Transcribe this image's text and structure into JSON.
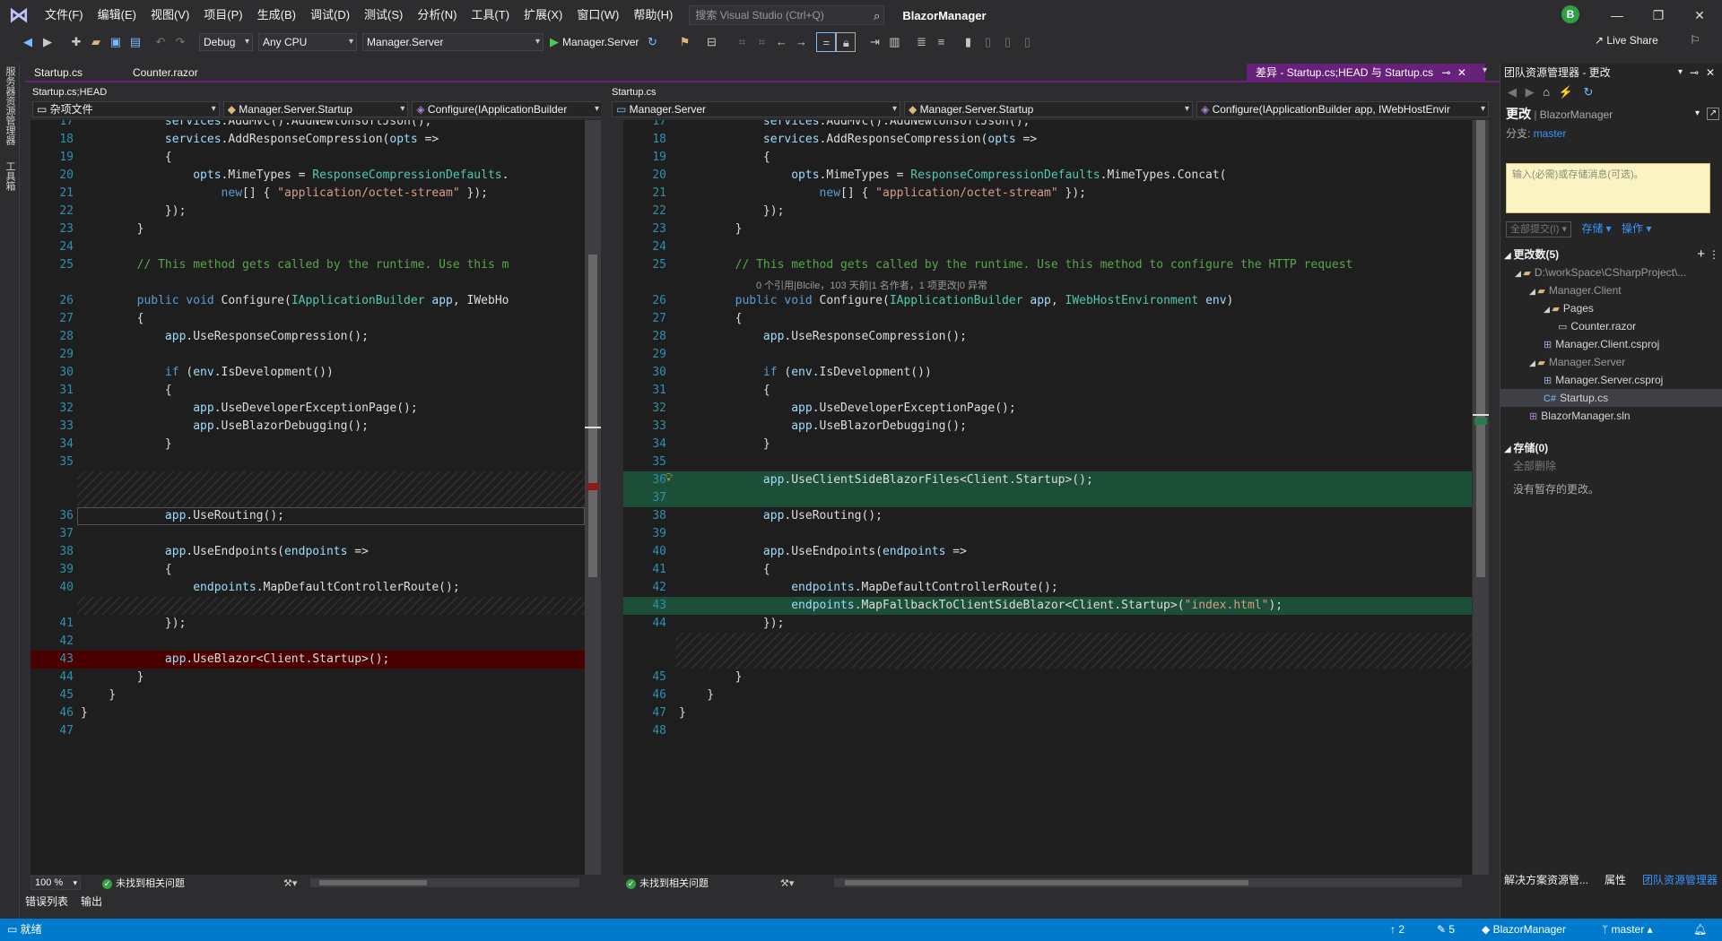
{
  "menubar": {
    "items": [
      "文件(F)",
      "编辑(E)",
      "视图(V)",
      "项目(P)",
      "生成(B)",
      "调试(D)",
      "测试(S)",
      "分析(N)",
      "工具(T)",
      "扩展(X)",
      "窗口(W)",
      "帮助(H)"
    ],
    "search_placeholder": "搜索 Visual Studio (Ctrl+Q)",
    "solution_name": "BlazorManager",
    "avatar_initial": "B"
  },
  "toolbar": {
    "config": "Debug",
    "platform": "Any CPU",
    "startup_project": "Manager.Server",
    "run_label": "Manager.Server",
    "live_share": "Live Share"
  },
  "side_tabs": [
    "服务器资源管理器",
    "工具箱"
  ],
  "tabs": {
    "tab1": "Startup.cs",
    "tab2": "Counter.razor",
    "active": "差异 - Startup.cs;HEAD 与 Startup.cs"
  },
  "left_pane": {
    "path": "Startup.cs;HEAD",
    "nav": [
      "杂项文件",
      "Manager.Server.Startup",
      "Configure(IApplicationBuilder"
    ],
    "zoom": "100 %",
    "issues": "未找到相关问题",
    "lines": [
      {
        "n": "17",
        "t": "            services.AddMvc().AddNewtonsoftJson();"
      },
      {
        "n": "18",
        "t": "            services.AddResponseCompression(opts =>"
      },
      {
        "n": "19",
        "t": "            {"
      },
      {
        "n": "20",
        "t": "                opts.MimeTypes = ResponseCompressionDefaults."
      },
      {
        "n": "21",
        "t": "                    new[] { \"application/octet-stream\" });"
      },
      {
        "n": "22",
        "t": "            });"
      },
      {
        "n": "23",
        "t": "        }"
      },
      {
        "n": "24",
        "t": ""
      },
      {
        "n": "25",
        "t": "        // This method gets called by the runtime. Use this m"
      },
      {
        "n": "",
        "t": ""
      },
      {
        "n": "26",
        "t": "        public void Configure(IApplicationBuilder app, IWebHo"
      },
      {
        "n": "27",
        "t": "        {"
      },
      {
        "n": "28",
        "t": "            app.UseResponseCompression();"
      },
      {
        "n": "29",
        "t": ""
      },
      {
        "n": "30",
        "t": "            if (env.IsDevelopment())"
      },
      {
        "n": "31",
        "t": "            {"
      },
      {
        "n": "32",
        "t": "                app.UseDeveloperExceptionPage();"
      },
      {
        "n": "33",
        "t": "                app.UseBlazorDebugging();"
      },
      {
        "n": "34",
        "t": "            }"
      },
      {
        "n": "35",
        "t": ""
      },
      {
        "n": "",
        "t": ""
      },
      {
        "n": "",
        "t": ""
      },
      {
        "n": "36",
        "t": "            app.UseRouting();"
      },
      {
        "n": "37",
        "t": ""
      },
      {
        "n": "38",
        "t": "            app.UseEndpoints(endpoints =>"
      },
      {
        "n": "39",
        "t": "            {"
      },
      {
        "n": "40",
        "t": "                endpoints.MapDefaultControllerRoute();"
      },
      {
        "n": "",
        "t": ""
      },
      {
        "n": "41",
        "t": "            });"
      },
      {
        "n": "42",
        "t": ""
      },
      {
        "n": "43",
        "t": "            app.UseBlazor<Client.Startup>();"
      },
      {
        "n": "44",
        "t": "        }"
      },
      {
        "n": "45",
        "t": "    }"
      },
      {
        "n": "46",
        "t": "}"
      },
      {
        "n": "47",
        "t": ""
      }
    ]
  },
  "right_pane": {
    "path": "Startup.cs",
    "nav": [
      "Manager.Server",
      "Manager.Server.Startup",
      "Configure(IApplicationBuilder app, IWebHostEnvir"
    ],
    "issues": "未找到相关问题",
    "codelens": "0 个引用|Blcile，103 天前|1 名作者，1 项更改|0 异常",
    "lines": [
      {
        "n": "17",
        "t": "            services.AddMvc().AddNewtonsoftJson();"
      },
      {
        "n": "18",
        "t": "            services.AddResponseCompression(opts =>"
      },
      {
        "n": "19",
        "t": "            {"
      },
      {
        "n": "20",
        "t": "                opts.MimeTypes = ResponseCompressionDefaults.MimeTypes.Concat("
      },
      {
        "n": "21",
        "t": "                    new[] { \"application/octet-stream\" });"
      },
      {
        "n": "22",
        "t": "            });"
      },
      {
        "n": "23",
        "t": "        }"
      },
      {
        "n": "24",
        "t": ""
      },
      {
        "n": "25",
        "t": "        // This method gets called by the runtime. Use this method to configure the HTTP request"
      },
      {
        "n": "",
        "t": ""
      },
      {
        "n": "26",
        "t": "        public void Configure(IApplicationBuilder app, IWebHostEnvironment env)"
      },
      {
        "n": "27",
        "t": "        {"
      },
      {
        "n": "28",
        "t": "            app.UseResponseCompression();"
      },
      {
        "n": "29",
        "t": ""
      },
      {
        "n": "30",
        "t": "            if (env.IsDevelopment())"
      },
      {
        "n": "31",
        "t": "            {"
      },
      {
        "n": "32",
        "t": "                app.UseDeveloperExceptionPage();"
      },
      {
        "n": "33",
        "t": "                app.UseBlazorDebugging();"
      },
      {
        "n": "34",
        "t": "            }"
      },
      {
        "n": "35",
        "t": ""
      },
      {
        "n": "36",
        "t": "            app.UseClientSideBlazorFiles<Client.Startup>();"
      },
      {
        "n": "37",
        "t": ""
      },
      {
        "n": "38",
        "t": "            app.UseRouting();"
      },
      {
        "n": "39",
        "t": ""
      },
      {
        "n": "40",
        "t": "            app.UseEndpoints(endpoints =>"
      },
      {
        "n": "41",
        "t": "            {"
      },
      {
        "n": "42",
        "t": "                endpoints.MapDefaultControllerRoute();"
      },
      {
        "n": "43",
        "t": "                endpoints.MapFallbackToClientSideBlazor<Client.Startup>(\"index.html\");"
      },
      {
        "n": "44",
        "t": "            });"
      },
      {
        "n": "",
        "t": ""
      },
      {
        "n": "",
        "t": ""
      },
      {
        "n": "45",
        "t": "        }"
      },
      {
        "n": "46",
        "t": "    }"
      },
      {
        "n": "47",
        "t": "}"
      },
      {
        "n": "48",
        "t": ""
      }
    ]
  },
  "bottom_tabs": [
    "错误列表",
    "输出"
  ],
  "team_explorer": {
    "title": "团队资源管理器 - 更改",
    "heading": "更改",
    "repo": "BlazorManager",
    "branch_label": "分支:",
    "branch": "master",
    "message_placeholder": "输入(必需)或存储消息(可选)。",
    "commit_all": "全部提交(I)",
    "stash": "存储",
    "actions": "操作",
    "changes_header": "更改数(5)",
    "tree": [
      {
        "label": "D:\\workSpace\\CSharpProject\\...",
        "icon": "folder"
      },
      {
        "label": "Manager.Client",
        "icon": "folder"
      },
      {
        "label": "Pages",
        "icon": "folder"
      },
      {
        "label": "Counter.razor",
        "icon": "file"
      },
      {
        "label": "Manager.Client.csproj",
        "icon": "csproj"
      },
      {
        "label": "Manager.Server",
        "icon": "folder"
      },
      {
        "label": "Manager.Server.csproj",
        "icon": "csproj"
      },
      {
        "label": "Startup.cs",
        "icon": "cs"
      },
      {
        "label": "BlazorManager.sln",
        "icon": "sln"
      }
    ],
    "stash_header": "存储(0)",
    "delete_all": "全部删除",
    "no_stash": "没有暂存的更改。",
    "footer_tabs": [
      "解决方案资源管...",
      "属性",
      "团队资源管理器"
    ]
  },
  "status": {
    "ready": "就绪",
    "up": "2",
    "edits": "5",
    "repo": "BlazorManager",
    "branch": "master"
  },
  "colors": {
    "accent": "#68217a",
    "status": "#007acc",
    "added": "#1e5a3c",
    "removed": "#5a0000"
  }
}
